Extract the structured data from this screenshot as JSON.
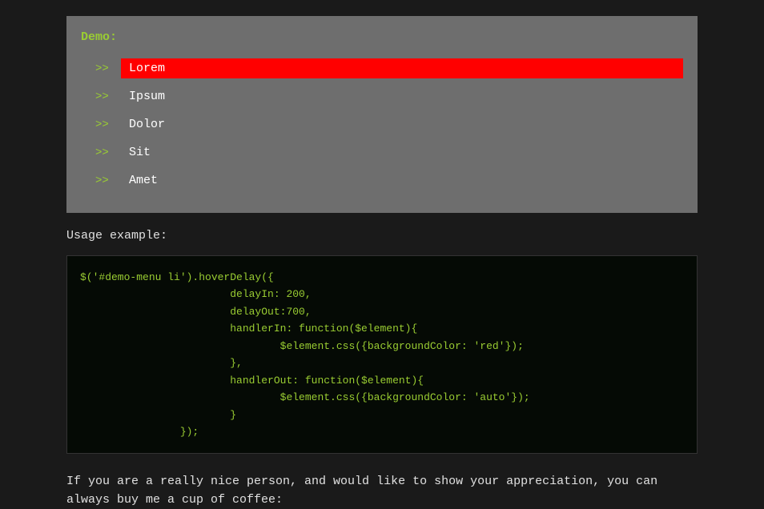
{
  "demo": {
    "title": "Demo:",
    "items": [
      {
        "label": "Lorem",
        "active": true
      },
      {
        "label": "Ipsum",
        "active": false
      },
      {
        "label": "Dolor",
        "active": false
      },
      {
        "label": "Sit",
        "active": false
      },
      {
        "label": "Amet",
        "active": false
      }
    ],
    "arrow": ">>"
  },
  "usage": {
    "label": "Usage example:",
    "code": "$('#demo-menu li').hoverDelay({\n                        delayIn: 200,\n                        delayOut:700,\n                        handlerIn: function($element){\n                                $element.css({backgroundColor: 'red'});\n                        },\n                        handlerOut: function($element){\n                                $element.css({backgroundColor: 'auto'});\n                        }\n                });"
  },
  "footer": {
    "text": "If you are a really nice person, and would like to show your appreciation, you can always buy me a cup of coffee:"
  }
}
